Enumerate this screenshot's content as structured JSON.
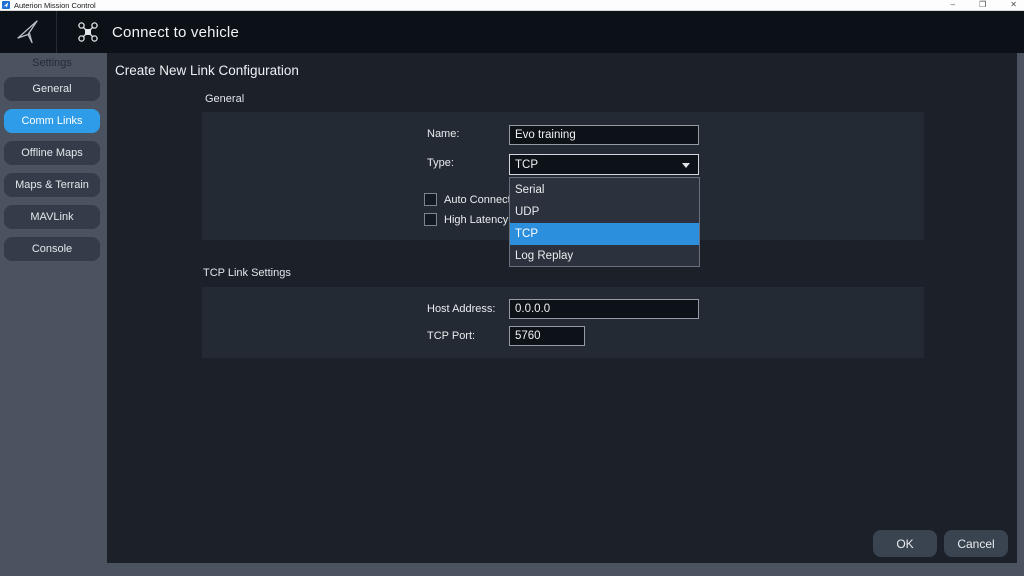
{
  "titlebar": {
    "app_title": "Auterion Mission Control",
    "controls": {
      "minimize": "–",
      "maximize": "❐",
      "close": "✕"
    }
  },
  "header": {
    "title": "Connect to vehicle"
  },
  "sidebar": {
    "heading": "Settings",
    "items": [
      {
        "label": "General",
        "selected": false
      },
      {
        "label": "Comm Links",
        "selected": true
      },
      {
        "label": "Offline Maps",
        "selected": false
      },
      {
        "label": "Maps & Terrain",
        "selected": false
      },
      {
        "label": "MAVLink",
        "selected": false
      },
      {
        "label": "Console",
        "selected": false
      }
    ]
  },
  "main": {
    "title": "Create New Link Configuration",
    "general_section": {
      "heading": "General",
      "name_label": "Name:",
      "name_value": "Evo training",
      "type_label": "Type:",
      "type_value": "TCP",
      "auto_connect_label": "Auto Connect",
      "auto_connect_checked": false,
      "high_latency_label": "High Latency",
      "high_latency_checked": false
    },
    "type_dropdown": {
      "options": [
        {
          "label": "Serial",
          "selected": false
        },
        {
          "label": "UDP",
          "selected": false
        },
        {
          "label": "TCP",
          "selected": true
        },
        {
          "label": "Log Replay",
          "selected": false
        }
      ]
    },
    "tcp_section": {
      "heading": "TCP Link Settings",
      "host_label": "Host Address:",
      "host_value": "0.0.0.0",
      "port_label": "TCP Port:",
      "port_value": "5760"
    },
    "buttons": {
      "ok": "OK",
      "cancel": "Cancel"
    }
  },
  "colors": {
    "accent_blue": "#2e9ce8",
    "dropdown_highlight": "#2b8fdd",
    "header_bg": "#0c1017",
    "content_bg": "#1c2129",
    "panel_bg": "#242a34",
    "chrome_gray": "#4c5360"
  }
}
